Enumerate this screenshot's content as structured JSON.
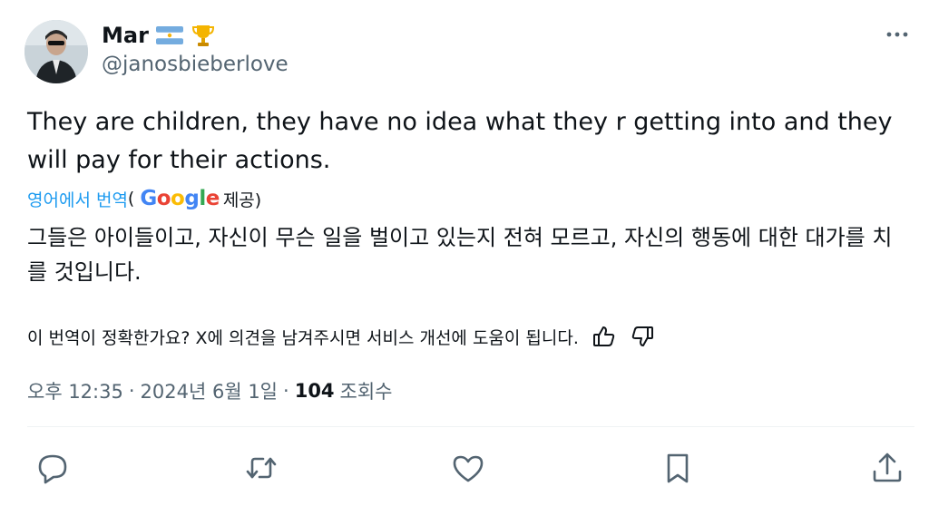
{
  "user": {
    "display_name": "Mar",
    "handle": "@janosbieberlove",
    "badges": [
      "argentina-flag-emoji",
      "trophy-emoji"
    ]
  },
  "tweet": {
    "text": "They are children, they have no idea what they r getting into and they will pay for their actions."
  },
  "translation": {
    "prefix": "영어에서 번역",
    "open_paren": "(",
    "provider": "Google",
    "suffix": "제공)",
    "text": "그들은 아이들이고, 자신이 무슨 일을 벌이고 있는지 전혀 모르고, 자신의 행동에 대한 대가를 치를 것입니다.",
    "feedback_prompt": "이 번역이 정확한가요? X에 의견을 남겨주시면 서비스 개선에 도움이 됩니다."
  },
  "meta": {
    "time": "오후 12:35",
    "separator1": "·",
    "date": "2024년 6월 1일",
    "separator2": "·",
    "views_count": "104",
    "views_label": "조회수"
  },
  "icons": {
    "more": "more-horizontal-icon",
    "reply": "reply-icon",
    "retweet": "retweet-icon",
    "like": "heart-icon",
    "bookmark": "bookmark-icon",
    "share": "share-icon",
    "thumbs_up": "thumbs-up-icon",
    "thumbs_down": "thumbs-down-icon"
  },
  "colors": {
    "text": "#0f1419",
    "secondary": "#536471",
    "link": "#1d9bf0"
  }
}
